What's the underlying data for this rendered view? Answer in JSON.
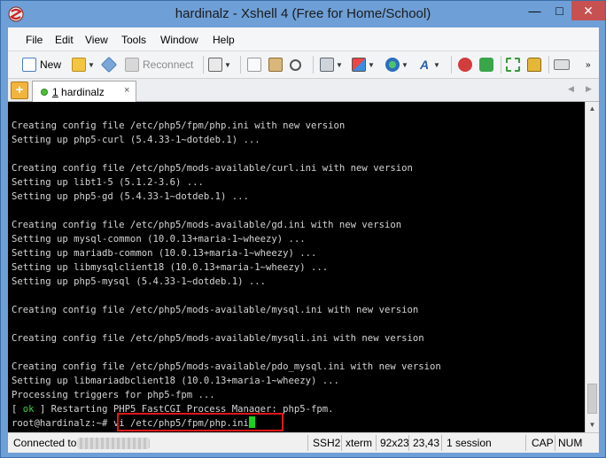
{
  "window": {
    "title": "hardinalz - Xshell 4 (Free for Home/School)",
    "minimize": "—",
    "maximize": "□",
    "close": "✕"
  },
  "menu": [
    "File",
    "Edit",
    "View",
    "Tools",
    "Window",
    "Help"
  ],
  "toolbar": {
    "new_label": "New",
    "reconnect_label": "Reconnect"
  },
  "tabs": [
    {
      "number": "1",
      "label": "hardinalz",
      "close": "×",
      "status": "connected"
    }
  ],
  "tab_nav": {
    "prev": "◀",
    "next": "▶"
  },
  "terminal": {
    "lines": [
      "Creating config file /etc/php5/fpm/php.ini with new version",
      "Setting up php5-curl (5.4.33-1~dotdeb.1) ...",
      "",
      "Creating config file /etc/php5/mods-available/curl.ini with new version",
      "Setting up libt1-5 (5.1.2-3.6) ...",
      "Setting up php5-gd (5.4.33-1~dotdeb.1) ...",
      "",
      "Creating config file /etc/php5/mods-available/gd.ini with new version",
      "Setting up mysql-common (10.0.13+maria-1~wheezy) ...",
      "Setting up mariadb-common (10.0.13+maria-1~wheezy) ...",
      "Setting up libmysqlclient18 (10.0.13+maria-1~wheezy) ...",
      "Setting up php5-mysql (5.4.33-1~dotdeb.1) ...",
      "",
      "Creating config file /etc/php5/mods-available/mysql.ini with new version",
      "",
      "Creating config file /etc/php5/mods-available/mysqli.ini with new version",
      "",
      "Creating config file /etc/php5/mods-available/pdo_mysql.ini with new version",
      "Setting up libmariadbclient18 (10.0.13+maria-1~wheezy) ...",
      "Processing triggers for php5-fpm ..."
    ],
    "ok_line": {
      "open": "[ ",
      "ok": "ok",
      "rest": " ] Restarting PHP5 FastCGI Process Manager: php5-fpm."
    },
    "prompt": "root@hardinalz:~# ",
    "command": "vi /etc/php5/fpm/php.ini"
  },
  "status": {
    "connection": "Connected to",
    "protocol": "SSH2",
    "terminal_type": "xterm",
    "size": "92x23",
    "cursor": "23,43",
    "sessions": "1 session",
    "caps": "CAP",
    "num": "NUM"
  },
  "colors": {
    "accent": "#6e9fd6",
    "terminal_bg": "#000000",
    "terminal_fg": "#d4d4d4",
    "ok": "#3fd43f",
    "cursor": "#19d219",
    "highlight": "#e01818"
  }
}
